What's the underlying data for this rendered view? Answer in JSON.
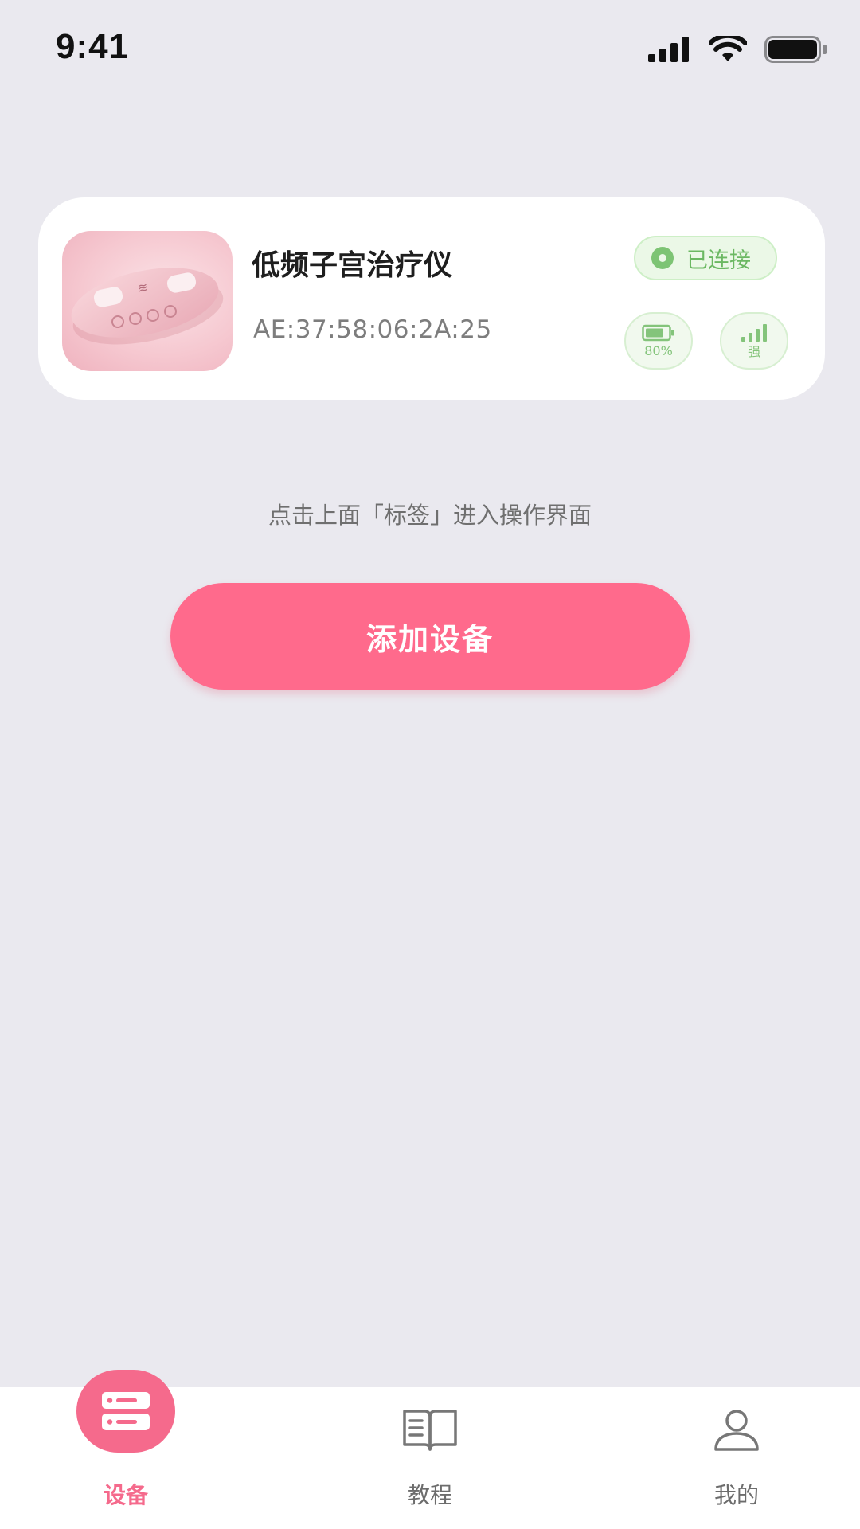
{
  "status_bar": {
    "time": "9:41"
  },
  "device_card": {
    "name": "低频子宫治疗仪",
    "mac": "AE:37:58:06:2A:25",
    "connection_status": "已连接",
    "battery_label": "80%",
    "battery_level": 0.8,
    "signal_label": "强"
  },
  "hint_text": "点击上面「标签」进入操作界面",
  "add_button_label": "添加设备",
  "tab_bar": {
    "active": "设备",
    "tabs": [
      {
        "label": "设备",
        "icon": "device-list-icon"
      },
      {
        "label": "教程",
        "icon": "book-icon"
      },
      {
        "label": "我的",
        "icon": "user-icon"
      }
    ]
  },
  "colors": {
    "accent": "#FF6A8C",
    "background": "#EAE9EF",
    "connected_green": "#7DC474"
  }
}
